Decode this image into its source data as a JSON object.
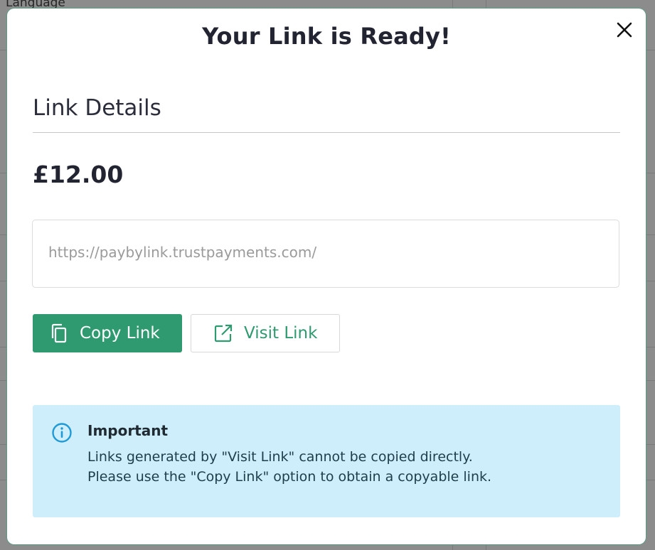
{
  "background": {
    "texts": [
      "Language"
    ]
  },
  "modal": {
    "title": "Your Link is Ready!",
    "close_icon": "close-icon",
    "section_title": "Link Details",
    "amount": "£12.00",
    "link_url": "https://paybylink.trustpayments.com/",
    "copy_button": {
      "label": "Copy Link",
      "icon": "copy-icon"
    },
    "visit_button": {
      "label": "Visit Link",
      "icon": "external-link-icon"
    },
    "alert": {
      "icon": "info-icon",
      "title": "Important",
      "line1": "Links generated by \"Visit Link\" cannot be copied directly.",
      "line2": "Please use the \"Copy Link\" option to obtain a copyable link."
    }
  },
  "colors": {
    "accent": "#2f9a6f",
    "alert_bg": "#cdeefa",
    "info_icon": "#1f9ad6"
  }
}
